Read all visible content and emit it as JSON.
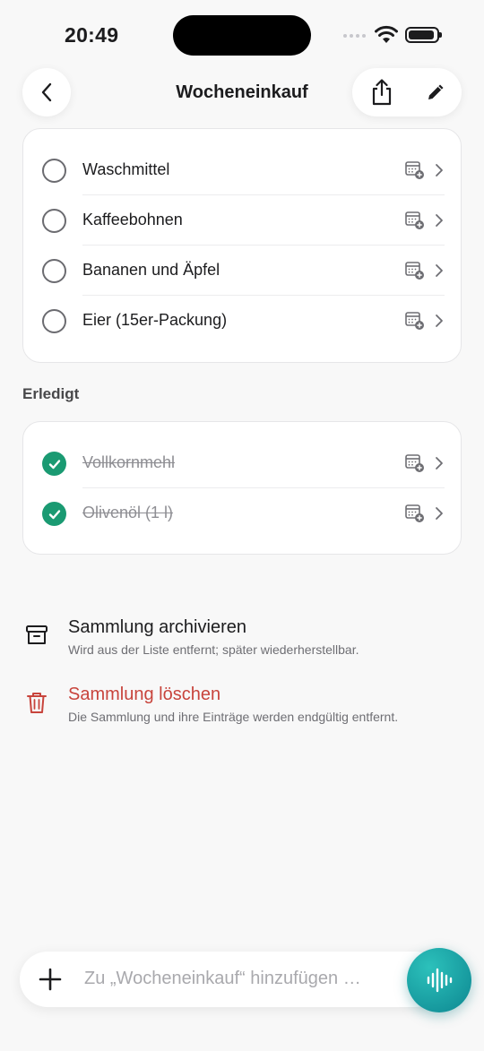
{
  "status_bar": {
    "time": "20:49"
  },
  "nav": {
    "title": "Wocheneinkauf"
  },
  "open_items": [
    {
      "label": "Waschmittel"
    },
    {
      "label": "Kaffeebohnen"
    },
    {
      "label": "Bananen und Äpfel"
    },
    {
      "label": "Eier (15er-Packung)"
    }
  ],
  "done_section": {
    "title": "Erledigt",
    "items": [
      {
        "label": "Vollkornmehl"
      },
      {
        "label": "Olivenöl (1 l)"
      }
    ]
  },
  "actions": {
    "archive": {
      "title": "Sammlung archivieren",
      "subtitle": "Wird aus der Liste entfernt; später wiederherstellbar."
    },
    "delete": {
      "title": "Sammlung löschen",
      "subtitle": "Die Sammlung und ihre Einträge werden endgültig entfernt."
    }
  },
  "add_bar": {
    "placeholder": "Zu „Wocheneinkauf“ hinzufügen …"
  },
  "colors": {
    "accent_green": "#1a9a72",
    "danger_red": "#c8443c",
    "voice_teal": "#0d8791"
  },
  "icons": [
    "back-chevron-icon",
    "share-icon",
    "pencil-icon",
    "calendar-add-icon",
    "chevron-right-icon",
    "checkmark-icon",
    "archive-box-icon",
    "trash-icon",
    "plus-icon",
    "waveform-icon"
  ]
}
